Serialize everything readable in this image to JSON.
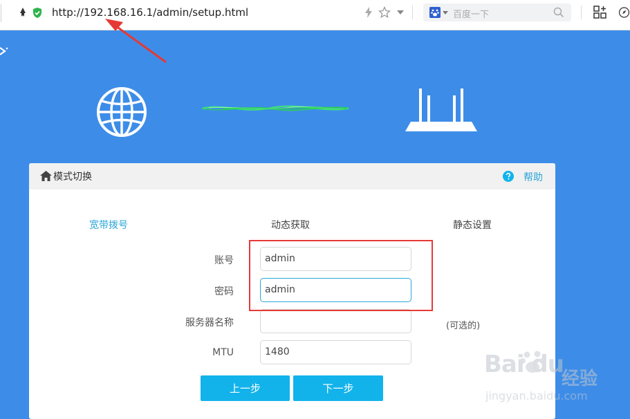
{
  "browser": {
    "url": "http://192.168.16.1/admin/setup.html",
    "search_placeholder": "百度一下"
  },
  "panel": {
    "title": "模式切换",
    "help_label": "帮助",
    "tabs": [
      {
        "label": "宽带拨号",
        "active": true
      },
      {
        "label": "动态获取",
        "active": false
      },
      {
        "label": "静态设置",
        "active": false
      }
    ],
    "fields": [
      {
        "label": "账号",
        "value": "admin"
      },
      {
        "label": "密码",
        "value": "admin"
      },
      {
        "label": "服务器名称",
        "value": ""
      },
      {
        "label": "MTU",
        "value": "1480"
      }
    ],
    "optional_note": "(可选的)",
    "prev_button": "上一步",
    "next_button": "下一步"
  },
  "watermark": {
    "brand": "Bai du",
    "cn": "经验",
    "url": "jingyan.baidu.com"
  },
  "colors": {
    "banner": "#3d8de8",
    "accent": "#2aa6d8",
    "button": "#12b3ea",
    "annotation": "#e53935"
  }
}
